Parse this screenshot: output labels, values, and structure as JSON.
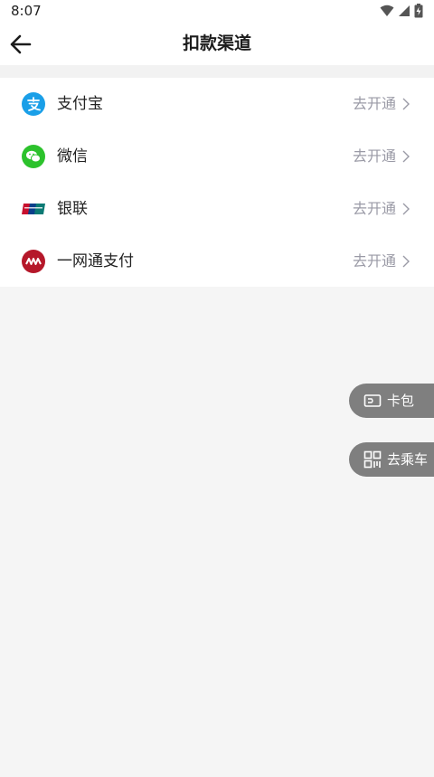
{
  "status_bar": {
    "time": "8:07",
    "icons": [
      "wifi-icon",
      "signal-icon",
      "battery-charging-icon"
    ]
  },
  "header": {
    "title": "扣款渠道",
    "back_icon": "arrow-left-icon"
  },
  "channels": [
    {
      "label": "支付宝",
      "action": "去开通",
      "icon": "alipay-logo",
      "color": "#1a9fe8"
    },
    {
      "label": "微信",
      "action": "去开通",
      "icon": "wechat-logo",
      "color": "#2cc22c"
    },
    {
      "label": "银联",
      "action": "去开通",
      "icon": "unionpay-logo",
      "color": "#c8102e"
    },
    {
      "label": "一网通支付",
      "action": "去开通",
      "icon": "cmb-one-net-logo",
      "color": "#b5182a"
    }
  ],
  "floating": {
    "card_wallet": {
      "label": "卡包",
      "icon": "card-icon"
    },
    "ride": {
      "label": "去乘车",
      "icon": "qr-code-icon"
    }
  },
  "colors": {
    "background": "#f5f5f5",
    "action_text": "#9a9aa6",
    "floating_bg": "#7f7f7f"
  }
}
